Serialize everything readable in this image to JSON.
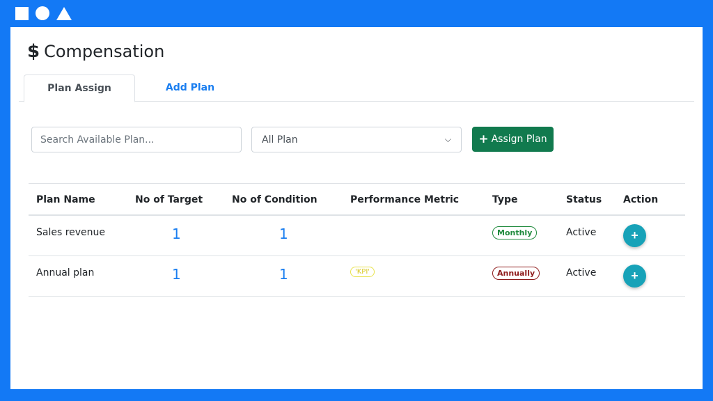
{
  "header": {
    "title": "Compensation",
    "title_icon": "dollar-icon",
    "shapes": [
      "square",
      "circle",
      "triangle"
    ]
  },
  "tabs": [
    {
      "label": "Plan Assign",
      "active": true
    },
    {
      "label": "Add Plan",
      "active": false
    }
  ],
  "filters": {
    "search_placeholder": "Search Available Plan...",
    "select_value": "All Plan",
    "assign_label": "Assign Plan"
  },
  "table": {
    "headers": [
      "Plan Name",
      "No of Target",
      "No of Condition",
      "Performance Metric",
      "Type",
      "Status",
      "Action"
    ],
    "rows": [
      {
        "name": "Sales revenue",
        "targets": "1",
        "conditions": "1",
        "metric": "",
        "type": "Monthly",
        "status": "Active"
      },
      {
        "name": "Annual plan",
        "targets": "1",
        "conditions": "1",
        "metric": "'KPI'",
        "type": "Annually",
        "status": "Active"
      }
    ]
  },
  "colors": {
    "frame": "#1379f5",
    "assign_button": "#117a4e",
    "link": "#1a7ef0",
    "action_button": "#17a2b8",
    "monthly_badge": "#1e8a3c",
    "annually_badge": "#8e1b1b",
    "kpi_badge": "#e8e24a"
  }
}
